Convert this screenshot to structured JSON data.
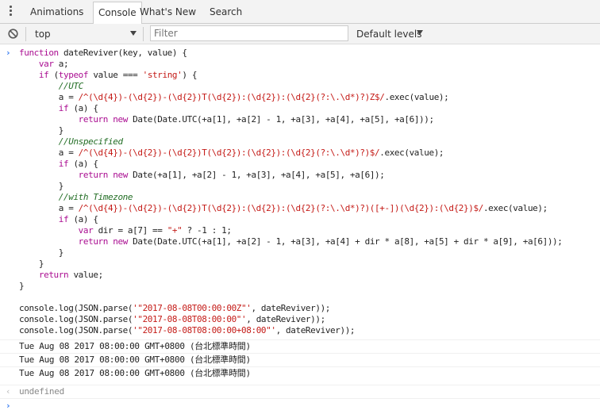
{
  "tabs": [
    "Animations",
    "Console",
    "What's New",
    "Search"
  ],
  "toolbar": {
    "context": "top",
    "filter_placeholder": "Filter",
    "levels": "Default levels"
  },
  "code_lines": [
    "function dateReviver(key, value) {",
    "    var a;",
    "    if (typeof value === 'string') {",
    "        //UTC",
    "        a = /^(\\d{4})-(\\d{2})-(\\d{2})T(\\d{2}):(\\d{2}):(\\d{2}(?:\\.\\d*)?)Z$/.exec(value);",
    "        if (a) {",
    "            return new Date(Date.UTC(+a[1], +a[2] - 1, +a[3], +a[4], +a[5], +a[6]));",
    "        }",
    "        //Unspecified",
    "        a = /^(\\d{4})-(\\d{2})-(\\d{2})T(\\d{2}):(\\d{2}):(\\d{2}(?:\\.\\d*)?)$/.exec(value);",
    "        if (a) {",
    "            return new Date(+a[1], +a[2] - 1, +a[3], +a[4], +a[5], +a[6]);",
    "        }",
    "        //with Timezone",
    "        a = /^(\\d{4})-(\\d{2})-(\\d{2})T(\\d{2}):(\\d{2}):(\\d{2}(?:\\.\\d*)?)([+-])(\\d{2}):(\\d{2})$/.exec(value);",
    "        if (a) {",
    "            var dir = a[7] == \"+\" ? -1 : 1;",
    "            return new Date(Date.UTC(+a[1], +a[2] - 1, +a[3], +a[4] + dir * a[8], +a[5] + dir * a[9], +a[6]));",
    "        }",
    "    }",
    "    return value;",
    "}",
    "",
    "console.log(JSON.parse('\"2017-08-08T00:00:00Z\"', dateReviver));",
    "console.log(JSON.parse('\"2017-08-08T08:00:00\"', dateReviver));",
    "console.log(JSON.parse('\"2017-08-08T08:00:00+08:00\"', dateReviver));"
  ],
  "outputs": [
    "Tue Aug 08 2017 08:00:00 GMT+0800 (台北標準時間)",
    "Tue Aug 08 2017 08:00:00 GMT+0800 (台北標準時間)",
    "Tue Aug 08 2017 08:00:00 GMT+0800 (台北標準時間)"
  ],
  "result": "undefined",
  "icons": {
    "menu": "kebab-menu-icon",
    "clear": "clear-console-icon",
    "context_dropdown": "triangle-down-icon",
    "levels_dropdown": "triangle-down-icon",
    "input_prompt": "chevron-right-icon",
    "result": "chevron-left-icon"
  },
  "colors": {
    "keyword": "#aa0d91",
    "string": "#c41a16",
    "comment": "#236e25",
    "prompt": "#367cf1"
  }
}
